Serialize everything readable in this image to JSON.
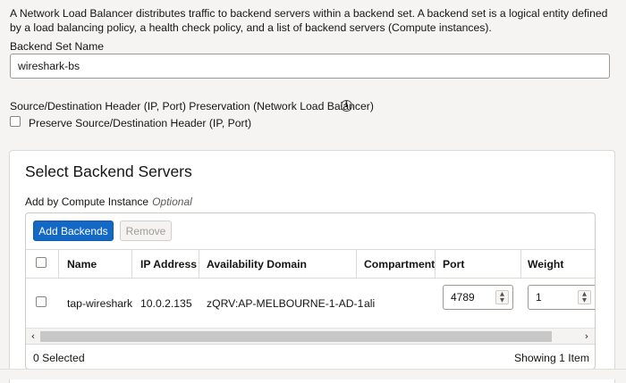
{
  "description": "A Network Load Balancer distributes traffic to backend servers within a backend set. A backend set is a logical entity defined by a load balancing policy, a health check policy, and a list of backend servers (Compute instances).",
  "backend_set": {
    "label": "Backend Set Name",
    "value": "wireshark-bs"
  },
  "preservation": {
    "label": "Source/Destination Header (IP, Port) Preservation (Network Load Balancer)",
    "info_icon": "info-icon",
    "checkbox_label": "Preserve Source/Destination Header (IP, Port)"
  },
  "panel": {
    "title": "Select Backend Servers",
    "add_by": "Add by Compute Instance",
    "optional": "Optional",
    "buttons": {
      "add": "Add Backends",
      "remove": "Remove"
    },
    "table": {
      "headers": [
        "Name",
        "IP Address",
        "Availability Domain",
        "Compartment",
        "Port",
        "Weight"
      ],
      "row": {
        "name": "tap-wireshark",
        "ip": "10.0.2.135",
        "ad": "zQRV:AP-MELBOURNE-1-AD-1",
        "compartment": "ali",
        "port": "4789",
        "weight": "1"
      }
    },
    "footer": {
      "selected": "0 Selected",
      "showing": "Showing 1 Item"
    }
  },
  "colors": {
    "primary_button": "#1468c5",
    "page_bg": "#f5f4f2"
  }
}
